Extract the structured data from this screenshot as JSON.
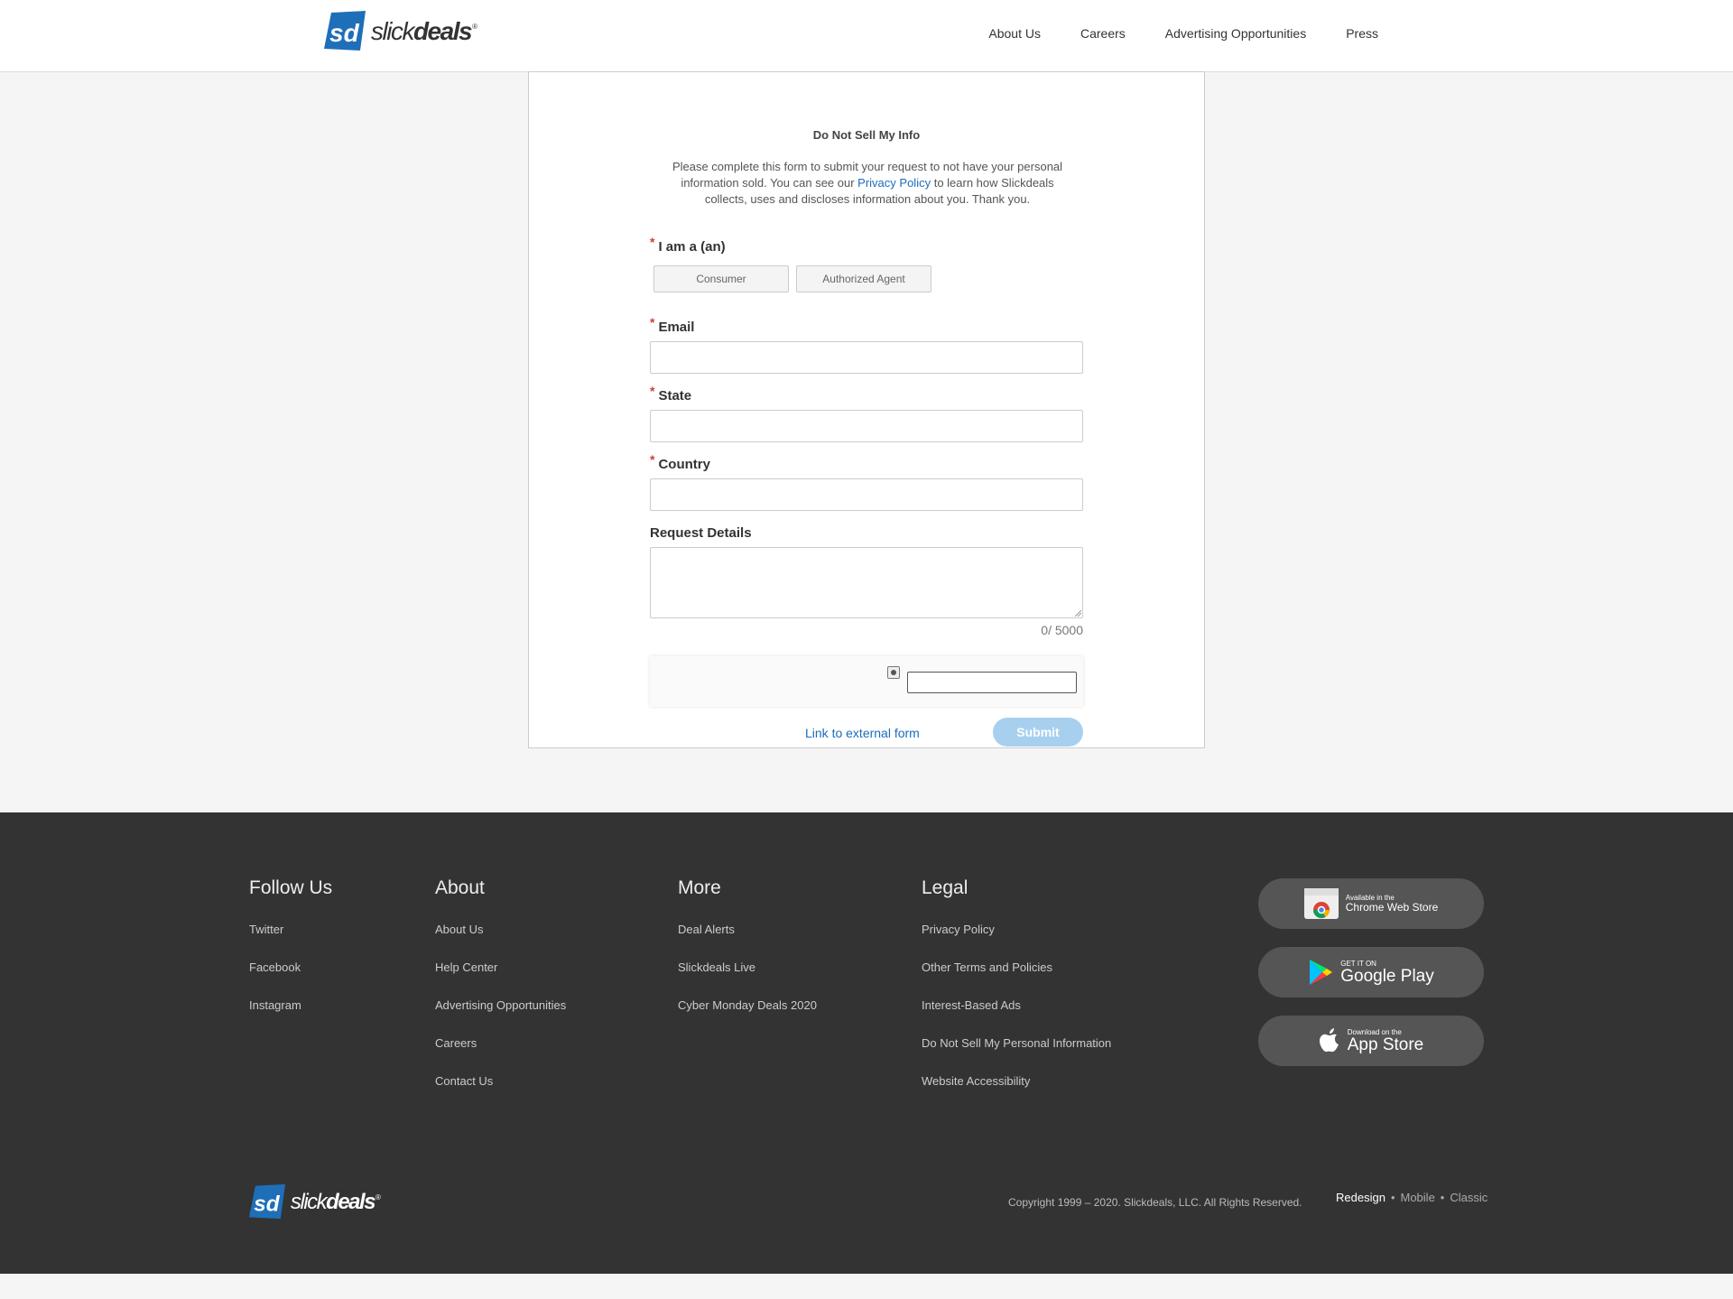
{
  "header": {
    "logo_text_light": "slick",
    "logo_text_bold": "deals",
    "logo_reg": "®",
    "nav": [
      "About Us",
      "Careers",
      "Advertising Opportunities",
      "Press"
    ]
  },
  "form": {
    "title": "Do Not Sell My Info",
    "intro_before": "Please complete this form to submit your request to not have your personal information sold. You can see our ",
    "intro_link": "Privacy Policy",
    "intro_after": " to learn how Slickdeals collects, uses and discloses information about you. Thank you.",
    "required_mark": "*",
    "iam_label": "I am a (an)",
    "iam_options": [
      "Consumer",
      "Authorized Agent"
    ],
    "email_label": "Email",
    "email_value": "",
    "state_label": "State",
    "state_value": "",
    "country_label": "Country",
    "country_value": "",
    "details_label": "Request Details",
    "details_value": "",
    "counter": "0/ 5000",
    "captcha_value": "",
    "external_link": "Link to external form",
    "submit_label": "Submit"
  },
  "footer": {
    "columns": [
      {
        "heading": "Follow Us",
        "links": [
          "Twitter",
          "Facebook",
          "Instagram"
        ]
      },
      {
        "heading": "About",
        "links": [
          "About Us",
          "Help Center",
          "Advertising Opportunities",
          "Careers",
          "Contact Us"
        ]
      },
      {
        "heading": "More",
        "links": [
          "Deal Alerts",
          "Slickdeals Live",
          "Cyber Monday Deals 2020"
        ]
      },
      {
        "heading": "Legal",
        "links": [
          "Privacy Policy",
          "Other Terms and Policies",
          "Interest-Based Ads",
          "Do Not Sell My Personal Information",
          "Website Accessibility"
        ]
      }
    ],
    "stores": {
      "chrome_small": "Available in the",
      "chrome_big": "Chrome Web Store",
      "google_small": "GET IT ON",
      "google_big": "Google Play",
      "apple_small": "Download on the",
      "apple_big": "App Store"
    },
    "copyright": "Copyright 1999 – 2020. Slickdeals, LLC. All Rights Reserved.",
    "views": [
      "Redesign",
      "Mobile",
      "Classic"
    ],
    "view_separator": "•"
  },
  "colors": {
    "accent_link": "#1a6dbd",
    "required": "#d53b3b",
    "submit_bg": "#a7d0ef",
    "footer_bg": "#333333",
    "logo_blue": "#1e6fb8"
  },
  "icons": [
    "slickdeals-logo-icon",
    "chrome-icon",
    "google-play-icon",
    "apple-icon",
    "captcha-icon",
    "resize-handle-icon"
  ]
}
